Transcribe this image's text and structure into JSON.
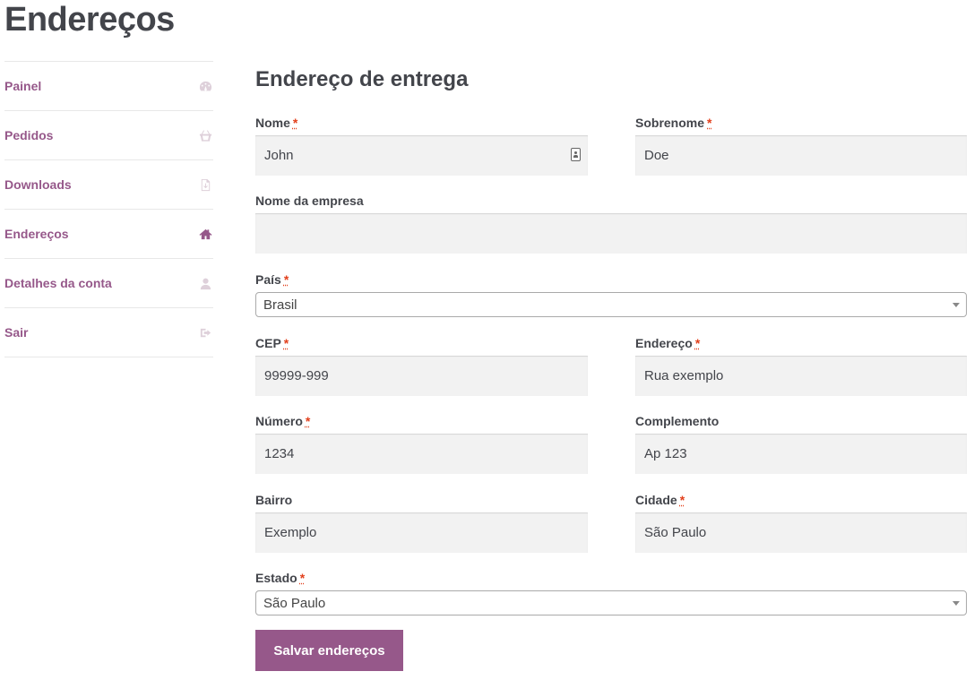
{
  "page": {
    "title": "Endereços"
  },
  "sidebar": {
    "items": [
      {
        "label": "Painel",
        "icon": "dashboard-icon"
      },
      {
        "label": "Pedidos",
        "icon": "basket-icon"
      },
      {
        "label": "Downloads",
        "icon": "file-download-icon"
      },
      {
        "label": "Endereços",
        "icon": "home-icon",
        "active": true
      },
      {
        "label": "Detalhes da conta",
        "icon": "user-icon"
      },
      {
        "label": "Sair",
        "icon": "sign-out-icon"
      }
    ]
  },
  "form": {
    "title": "Endereço de entrega",
    "required_mark": "*",
    "fields": {
      "first_name": {
        "label": "Nome",
        "value": "John"
      },
      "last_name": {
        "label": "Sobrenome",
        "value": "Doe"
      },
      "company": {
        "label": "Nome da empresa",
        "value": ""
      },
      "country": {
        "label": "País",
        "value": "Brasil"
      },
      "postcode": {
        "label": "CEP",
        "value": "99999-999"
      },
      "address": {
        "label": "Endereço",
        "value": "Rua exemplo"
      },
      "number": {
        "label": "Número",
        "value": "1234"
      },
      "complement": {
        "label": "Complemento",
        "value": "Ap 123"
      },
      "neighborhood": {
        "label": "Bairro",
        "value": "Exemplo"
      },
      "city": {
        "label": "Cidade",
        "value": "São Paulo"
      },
      "state": {
        "label": "Estado",
        "value": "São Paulo"
      }
    },
    "save_label": "Salvar endereços"
  },
  "colors": {
    "accent": "#96588a",
    "required": "#e2401c",
    "text": "#43454b",
    "input_bg": "#f2f2f2"
  }
}
